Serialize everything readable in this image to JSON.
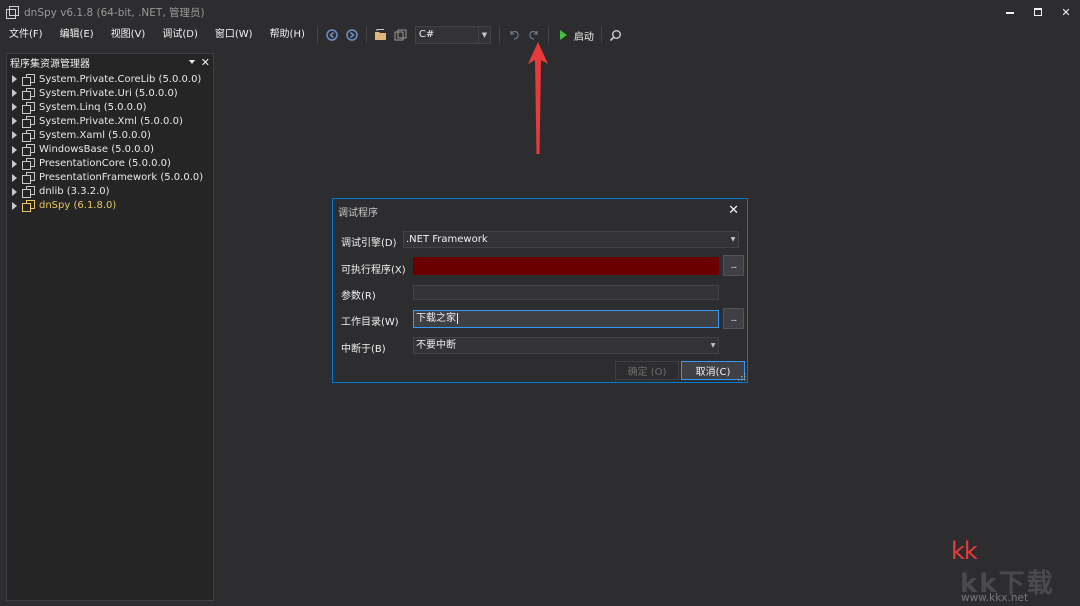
{
  "window": {
    "title": "dnSpy v6.1.8 (64-bit, .NET, 管理员)",
    "minimize": "▬",
    "maximize": "▢",
    "close": "✕"
  },
  "menu": [
    "文件(F)",
    "编辑(E)",
    "视图(V)",
    "调试(D)",
    "窗口(W)",
    "帮助(H)"
  ],
  "toolbar": {
    "language": "C#",
    "start_label": "启动",
    "start_icon_color": "#3ec13e"
  },
  "explorer": {
    "title": "程序集资源管理器",
    "items": [
      {
        "name": "System.Private.CoreLib",
        "version": "(5.0.0.0)"
      },
      {
        "name": "System.Private.Uri",
        "version": "(5.0.0.0)"
      },
      {
        "name": "System.Linq",
        "version": "(5.0.0.0)"
      },
      {
        "name": "System.Private.Xml",
        "version": "(5.0.0.0)"
      },
      {
        "name": "System.Xaml",
        "version": "(5.0.0.0)"
      },
      {
        "name": "WindowsBase",
        "version": "(5.0.0.0)"
      },
      {
        "name": "PresentationCore",
        "version": "(5.0.0.0)"
      },
      {
        "name": "PresentationFramework",
        "version": "(5.0.0.0)"
      },
      {
        "name": "dnlib",
        "version": "(3.3.2.0)"
      },
      {
        "name": "dnSpy",
        "version": "(6.1.8.0)"
      }
    ]
  },
  "dialog": {
    "title": "调试程序",
    "engine_label": "调试引擎(D)",
    "engine_value": ".NET Framework",
    "exe_label": "可执行程序(X)",
    "exe_value": "",
    "args_label": "参数(R)",
    "args_value": "",
    "workdir_label": "工作目录(W)",
    "workdir_value": "下载之家",
    "break_label": "中断于(B)",
    "break_value": "不要中断",
    "browse_label": "...",
    "ok_label": "确定 (O)",
    "cancel_label": "取消(C)"
  },
  "watermark": {
    "brand": "kk",
    "big": "kk下载",
    "url": "www.kkx.net"
  },
  "colors": {
    "background": "#2d2d30",
    "accent": "#007acc",
    "error": "#6b0000",
    "annotation": "#e83a3a",
    "highlight_item": "#e8c463"
  }
}
